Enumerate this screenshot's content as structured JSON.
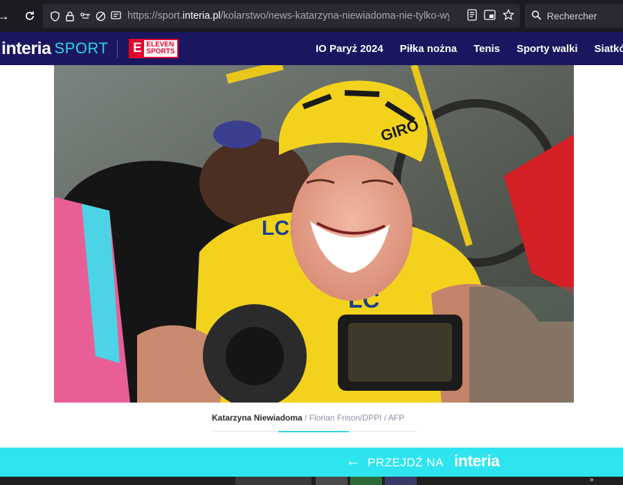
{
  "browser": {
    "url_prefix": "https://sport.",
    "url_domain": "interia.pl",
    "url_path": "/kolarstwo/news-katarzyna-niewiadoma-nie-tylko-wy",
    "search_placeholder": "Rechercher"
  },
  "site": {
    "logo": "interia",
    "section": "SPORT",
    "partner_logo_line1": "ELEVEN",
    "partner_logo_line2": "SPORTS",
    "partner_logo_letter": "E",
    "nav": [
      "IO Paryż 2024",
      "Piłka nożna",
      "Tenis",
      "Sporty walki",
      "Siatków"
    ]
  },
  "photo": {
    "caption_name": "Katarzyna Niewiadoma",
    "caption_credit": "/ Florian Frison/DPPI",
    "caption_agency": "/ AFP",
    "jersey_text": "LCL",
    "helmet_brand": "GIRO",
    "colors": {
      "jersey": "#f2d21c",
      "helmet": "#f2d21c"
    }
  },
  "banner": {
    "arrow": "←",
    "label": "PRZEJDŹ NA",
    "logo": "interia",
    "color": "#2ee4ef"
  },
  "colors": {
    "browser_bg": "#1c1b22",
    "header_bg": "#1a1760",
    "accent": "#2fd5e6"
  }
}
